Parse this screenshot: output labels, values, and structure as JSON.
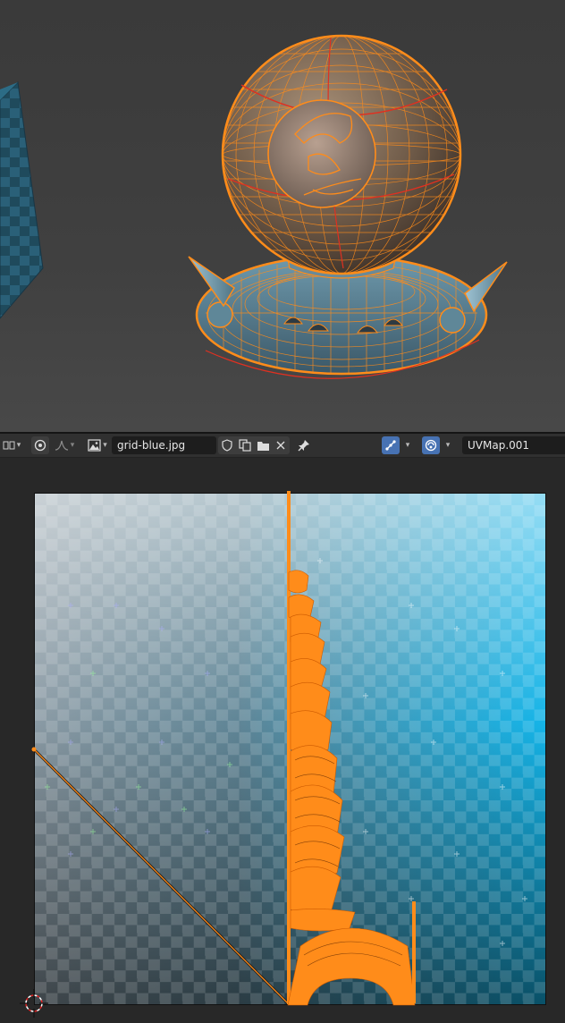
{
  "uv_header": {
    "image_name": "grid-blue.jpg",
    "uv_map": "UVMap.001",
    "icons": {
      "editor_type": "uv-editor-icon",
      "proportional": "proportional-edit-icon",
      "falloff": "falloff-curve-icon",
      "image": "image-icon",
      "fake_user": "shield-icon",
      "duplicate": "duplicate-icon",
      "open": "folder-icon",
      "unlink": "close-icon",
      "pin": "pin-icon",
      "sticky": "uv-sticky-icon",
      "sync": "sync-display-icon"
    }
  },
  "colors": {
    "selection": "#ff8c1a",
    "active_edge": "#e03020",
    "header_bg": "#303030",
    "field_bg": "#1d1d1d",
    "accent": "#4772b3"
  }
}
